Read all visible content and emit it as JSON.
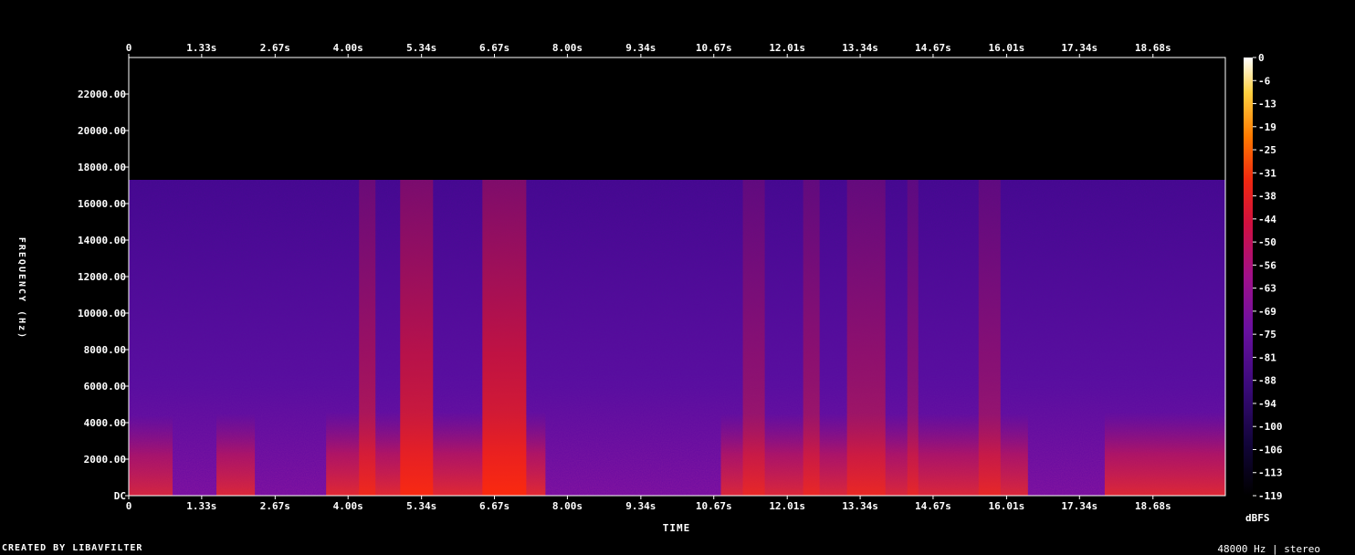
{
  "chart_data": {
    "type": "heatmap",
    "title": "",
    "xlabel": "TIME",
    "ylabel": "FREQUENCY (Hz)",
    "x_ticks": [
      "0",
      "1.33s",
      "2.67s",
      "4.00s",
      "5.34s",
      "6.67s",
      "8.00s",
      "9.34s",
      "10.67s",
      "12.01s",
      "13.34s",
      "14.67s",
      "16.01s",
      "17.34s",
      "18.68s"
    ],
    "x_tick_values": [
      0,
      1.33,
      2.67,
      4.0,
      5.34,
      6.67,
      8.0,
      9.34,
      10.67,
      12.01,
      13.34,
      14.67,
      16.01,
      17.34,
      18.68
    ],
    "xlim": [
      0,
      20.0
    ],
    "y_ticks": [
      "DC",
      "2000.00",
      "4000.00",
      "6000.00",
      "8000.00",
      "10000.00",
      "12000.00",
      "14000.00",
      "16000.00",
      "18000.00",
      "20000.00",
      "22000.00"
    ],
    "y_tick_values": [
      0,
      2000,
      4000,
      6000,
      8000,
      10000,
      12000,
      14000,
      16000,
      18000,
      20000,
      22000
    ],
    "ylim": [
      0,
      24000
    ],
    "cutoff_hz": 17300,
    "colorbar": {
      "label": "dBFS",
      "ticks": [
        "0",
        "-6",
        "-13",
        "-19",
        "-25",
        "-31",
        "-38",
        "-44",
        "-50",
        "-56",
        "-63",
        "-69",
        "-75",
        "-81",
        "-88",
        "-94",
        "-100",
        "-106",
        "-113",
        "-119"
      ],
      "range": [
        -119,
        0
      ]
    },
    "loud_segments": [
      {
        "start": 4.2,
        "end": 4.5,
        "level": 0.55
      },
      {
        "start": 4.95,
        "end": 5.55,
        "level": 0.78
      },
      {
        "start": 6.45,
        "end": 7.25,
        "level": 0.85
      },
      {
        "start": 11.2,
        "end": 11.6,
        "level": 0.4
      },
      {
        "start": 12.3,
        "end": 12.6,
        "level": 0.42
      },
      {
        "start": 13.1,
        "end": 13.8,
        "level": 0.45
      },
      {
        "start": 14.2,
        "end": 14.4,
        "level": 0.35
      },
      {
        "start": 15.5,
        "end": 15.9,
        "level": 0.38
      }
    ],
    "low_freq_energy": [
      {
        "start": 0.0,
        "end": 0.8,
        "level": 0.7
      },
      {
        "start": 1.6,
        "end": 2.3,
        "level": 0.75
      },
      {
        "start": 3.6,
        "end": 7.6,
        "level": 0.8
      },
      {
        "start": 10.8,
        "end": 16.4,
        "level": 0.75
      },
      {
        "start": 17.8,
        "end": 20.0,
        "level": 0.78
      }
    ]
  },
  "footer": {
    "left": "CREATED BY LIBAVFILTER",
    "right": "48000 Hz | stereo"
  }
}
